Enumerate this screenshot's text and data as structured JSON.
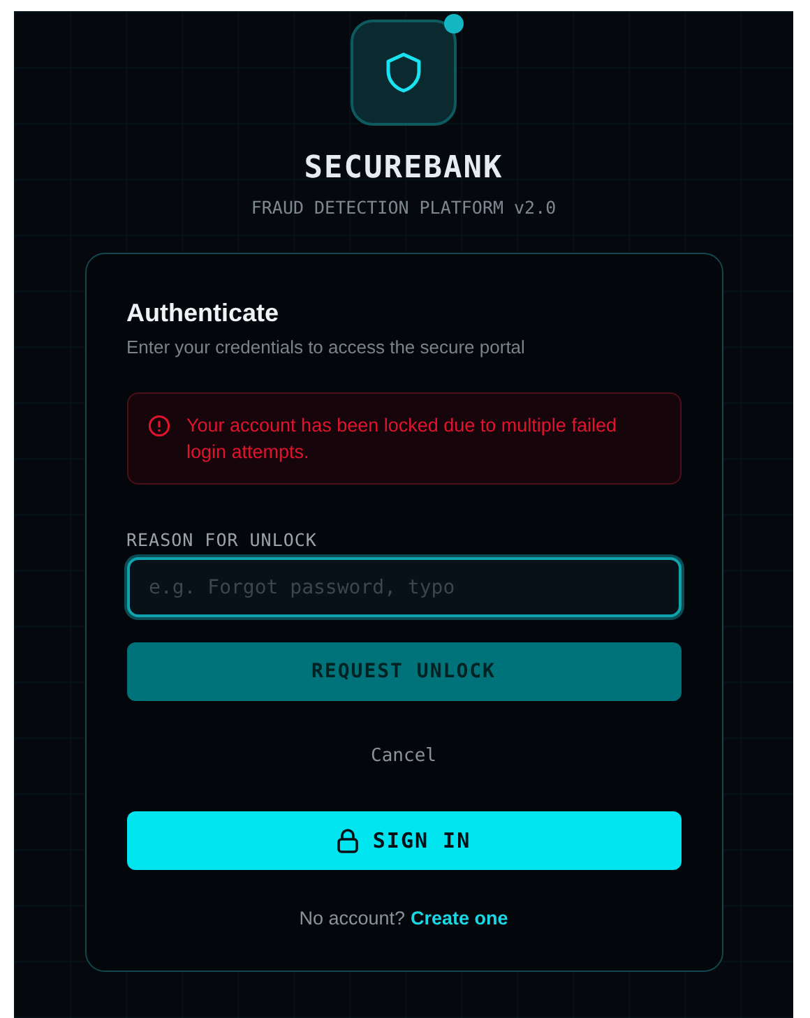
{
  "brand": {
    "name": "SECUREBANK",
    "tagline": "FRAUD DETECTION PLATFORM v2.0"
  },
  "card": {
    "title": "Authenticate",
    "subtitle": "Enter your credentials to access the secure portal",
    "alert": {
      "message": "Your account has been locked due to multiple failed login attempts."
    },
    "reason_field": {
      "label": "REASON FOR UNLOCK",
      "placeholder": "e.g. Forgot password, typo"
    },
    "request_button": "REQUEST UNLOCK",
    "cancel_link": "Cancel",
    "sign_in_button": "SIGN IN",
    "footer": {
      "text": "No account?",
      "link": "Create one"
    }
  }
}
